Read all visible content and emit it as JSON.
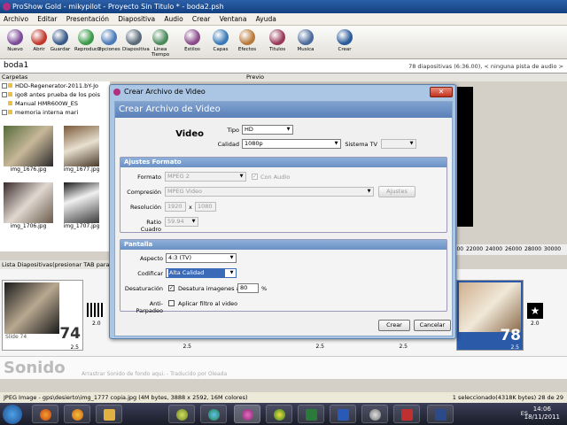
{
  "window": {
    "title": "ProShow Gold - mikypilot - Proyecto Sin Titulo * - boda2.psh"
  },
  "menu": [
    "Archivo",
    "Editar",
    "Presentación",
    "Diapositiva",
    "Audio",
    "Crear",
    "Ventana",
    "Ayuda"
  ],
  "toolbar": [
    {
      "label": "Nuevo",
      "icon": "new-icon",
      "color": "#7a4a9a"
    },
    {
      "label": "Abrir",
      "icon": "open-icon",
      "color": "#c0392b"
    },
    {
      "label": "Guardar",
      "icon": "save-icon",
      "color": "#3a5a8a"
    },
    {
      "label": "Reproducir",
      "icon": "play-icon",
      "color": "#3a9a4a"
    },
    {
      "label": "Opciones",
      "icon": "options-icon",
      "color": "#4a7ab8"
    },
    {
      "label": "Diapositiva",
      "icon": "slide-icon",
      "color": "#5a6a7a"
    },
    {
      "label": "Linea Tiempo",
      "icon": "timeline-icon",
      "color": "#4a8a5a"
    },
    {
      "label": "Estilos",
      "icon": "styles-icon",
      "color": "#8a4a8a"
    },
    {
      "label": "Capas",
      "icon": "layers-icon",
      "color": "#3a7ab8"
    },
    {
      "label": "Efectos",
      "icon": "effects-icon",
      "color": "#b87a3a"
    },
    {
      "label": "Titulos",
      "icon": "titles-icon",
      "color": "#9a3a5a"
    },
    {
      "label": "Musica",
      "icon": "music-icon",
      "color": "#4a6a9a"
    },
    {
      "label": "Crear",
      "icon": "create-icon",
      "color": "#2a5a9a"
    }
  ],
  "show": {
    "name": "boda1",
    "info": "78 diapositivas (6:36.00), < ninguna pista de audio >"
  },
  "folders": {
    "header": "Carpetas",
    "items": [
      "HDD-Regenerator-2011.bY-Jo",
      "igo8 antes prueba de los pois",
      "Manual HMR600W_ES",
      "memoria interna mari"
    ]
  },
  "thumbnails": [
    "img_1676.jpg",
    "img_1677.jpg",
    "img_1706.jpg",
    "img_1707.jpg"
  ],
  "preview": {
    "header": "Previo"
  },
  "timeline": {
    "ticks": [
      "20000",
      "22000",
      "24000",
      "26000",
      "28000",
      "30000"
    ]
  },
  "slide_list": {
    "header": "Lista Diapositivas(presionar TAB para a",
    "slides": [
      {
        "label": "Slide 74",
        "number": "74",
        "duration": "2.5"
      },
      {
        "label": "",
        "number": "",
        "duration": "2.0"
      },
      {
        "label": "",
        "number": "",
        "duration": "2.5"
      },
      {
        "label": "",
        "number": "",
        "duration": "2.5"
      },
      {
        "label": "",
        "number": "",
        "duration": "2.5"
      },
      {
        "label": "",
        "number": "78",
        "duration": "2.5"
      },
      {
        "label": "",
        "number": "",
        "duration": "2.0"
      }
    ]
  },
  "sonido": {
    "title": "Sonido",
    "hint": "Arrastrar Sonido de fondo aqui.   -   Traducido por Oleada"
  },
  "status": {
    "left": "JPEG Image - gps\\desierto\\img_1777 copia.jpg  (4M bytes, 3888 x 2592, 16M colores)",
    "right": "1 seleccionado(4318K bytes)  28 de 29"
  },
  "taskbar": {
    "time": "14:06",
    "date": "18/11/2011",
    "lang": "ES"
  },
  "dialog": {
    "title": "Crear Archivo de Video",
    "header": "Crear Archivo de Video",
    "close_label": "✕",
    "video_label": "Video",
    "tipo_label": "Tipo",
    "tipo_value": "HD",
    "calidad_label": "Calidad",
    "calidad_value": "1080p",
    "sistema_label": "Sistema TV",
    "sistema_value": "",
    "ajustes": {
      "header": "Ajustes Formato",
      "formato_label": "Formato",
      "formato_value": "MPEG 2",
      "con_audio_label": "Con Audio",
      "compresion_label": "Compresión",
      "compresion_value": "MPEG Video",
      "ajustes_button": "Ajustes",
      "resolucion_label": "Resolución",
      "res_w": "1920",
      "res_x": "x",
      "res_h": "1080",
      "ratio_label": "Ratio Cuadro",
      "ratio_value": "59.94"
    },
    "pantalla": {
      "header": "Pantalla",
      "aspecto_label": "Aspecto",
      "aspecto_value": "4:3 (TV)",
      "codificar_label": "Codificar",
      "codificar_value": "Alta Calidad",
      "desat_label": "Desaturación",
      "desat_check_label": "Desatura imagenes a",
      "desat_value": "80",
      "desat_unit": "%",
      "anti_label": "Anti-Parpadeo",
      "anti_check_label": "Aplicar filtro al video"
    },
    "crear_button": "Crear",
    "cancelar_button": "Cancelar"
  }
}
